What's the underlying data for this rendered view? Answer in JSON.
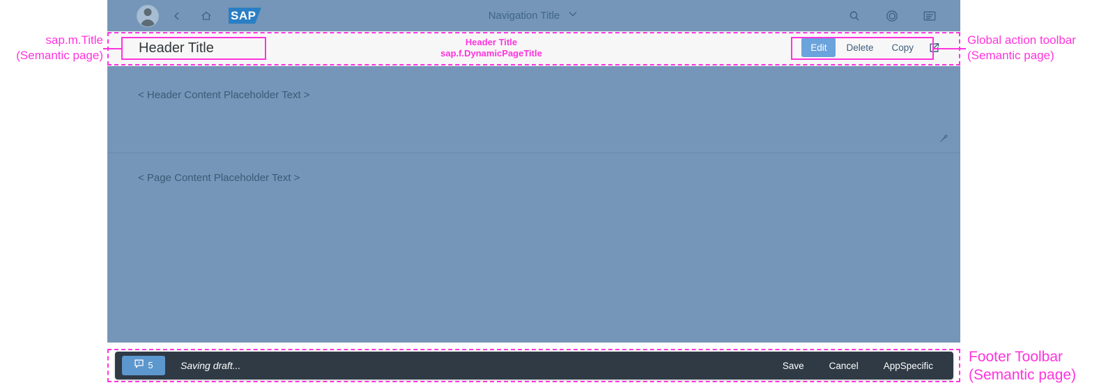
{
  "shell": {
    "avatar_name": "user-avatar",
    "back_label": "Back",
    "home_label": "Home",
    "logo_text": "SAP",
    "navigation_title": "Navigation Title",
    "search_label": "Search",
    "copilot_label": "CoPilot",
    "menu_label": "Me Area"
  },
  "page_title": {
    "header_title": "Header Title",
    "actions": [
      {
        "label": "Edit",
        "type": "emphasized"
      },
      {
        "label": "Delete",
        "type": "transparent"
      },
      {
        "label": "Copy",
        "type": "transparent"
      }
    ],
    "share_icon_label": "Share"
  },
  "header_content": {
    "placeholder": "< Header Content Placeholder Text >",
    "pin_label": "Pin header"
  },
  "page_content": {
    "placeholder": "< Page Content Placeholder Text >"
  },
  "footer": {
    "message_count": "5",
    "status_text": "Saving draft...",
    "actions": [
      {
        "label": "Save"
      },
      {
        "label": "Cancel"
      },
      {
        "label": "AppSpecific"
      }
    ]
  },
  "annotations": {
    "title_left": {
      "line1": "sap.m.Title",
      "line2": "(Semantic page)"
    },
    "title_center": {
      "line1": "Header Title",
      "line2": "sap.f.DynamicPageTitle"
    },
    "toolbar_right": {
      "line1": "Global action toolbar",
      "line2": "(Semantic page)"
    },
    "footer_right": {
      "line1": "Footer Toolbar",
      "line2": "(Semantic page)"
    }
  },
  "colors": {
    "shell_bar": "#7596b8",
    "title_bar": "#f7f7f7",
    "content": "#7596b8",
    "footer_bar": "#2f3a45",
    "emphasized_button": "#6ba3dc",
    "annotation": "#ff33dd"
  }
}
